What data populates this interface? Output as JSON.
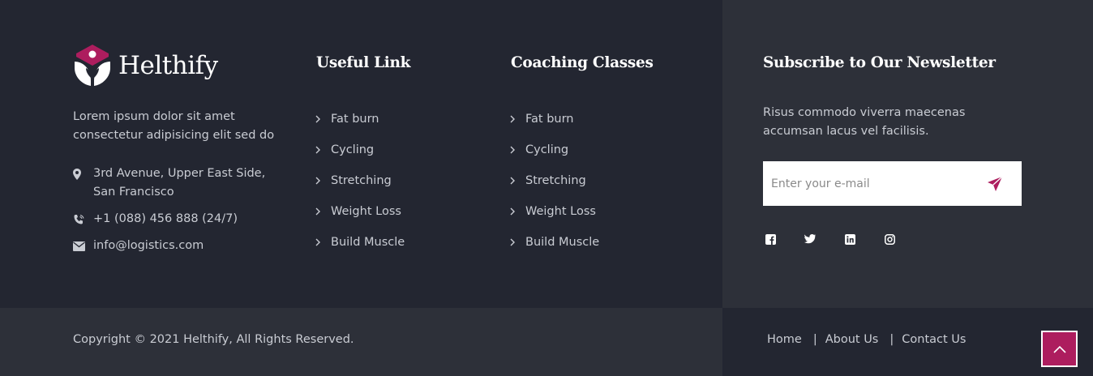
{
  "brand": {
    "name": "Helthify"
  },
  "about": {
    "text": "Lorem ipsum dolor sit amet consectetur adipisicing elit sed do"
  },
  "contact": {
    "address_line1": "3rd Avenue, Upper East Side,",
    "address_line2": "San Francisco",
    "phone": "+1 (088) 456 888 (24/7)",
    "email": "info@logistics.com"
  },
  "useful_links": {
    "title": "Useful Link",
    "items": [
      "Fat burn",
      "Cycling",
      "Stretching",
      "Weight Loss",
      "Build Muscle"
    ]
  },
  "coaching": {
    "title": "Coaching Classes",
    "items": [
      "Fat burn",
      "Cycling",
      "Stretching",
      "Weight Loss",
      "Build Muscle"
    ]
  },
  "newsletter": {
    "title": "Subscribe to Our Newsletter",
    "text": "Risus commodo viverra maecenas accumsan lacus vel facilisis.",
    "placeholder": "Enter your e-mail"
  },
  "socials": [
    "facebook-icon",
    "twitter-icon",
    "linkedin-icon",
    "instagram-icon"
  ],
  "bottom": {
    "copyright": "Copyright © 2021 Helthify, All Rights Reserved.",
    "nav": {
      "home": "Home",
      "about": "About Us",
      "contact": "Contact Us",
      "separator": "|"
    }
  },
  "colors": {
    "accent": "#ad1d5e",
    "bg_dark": "#232631",
    "bg_light": "#2d3039",
    "text": "#c9ccd3"
  }
}
